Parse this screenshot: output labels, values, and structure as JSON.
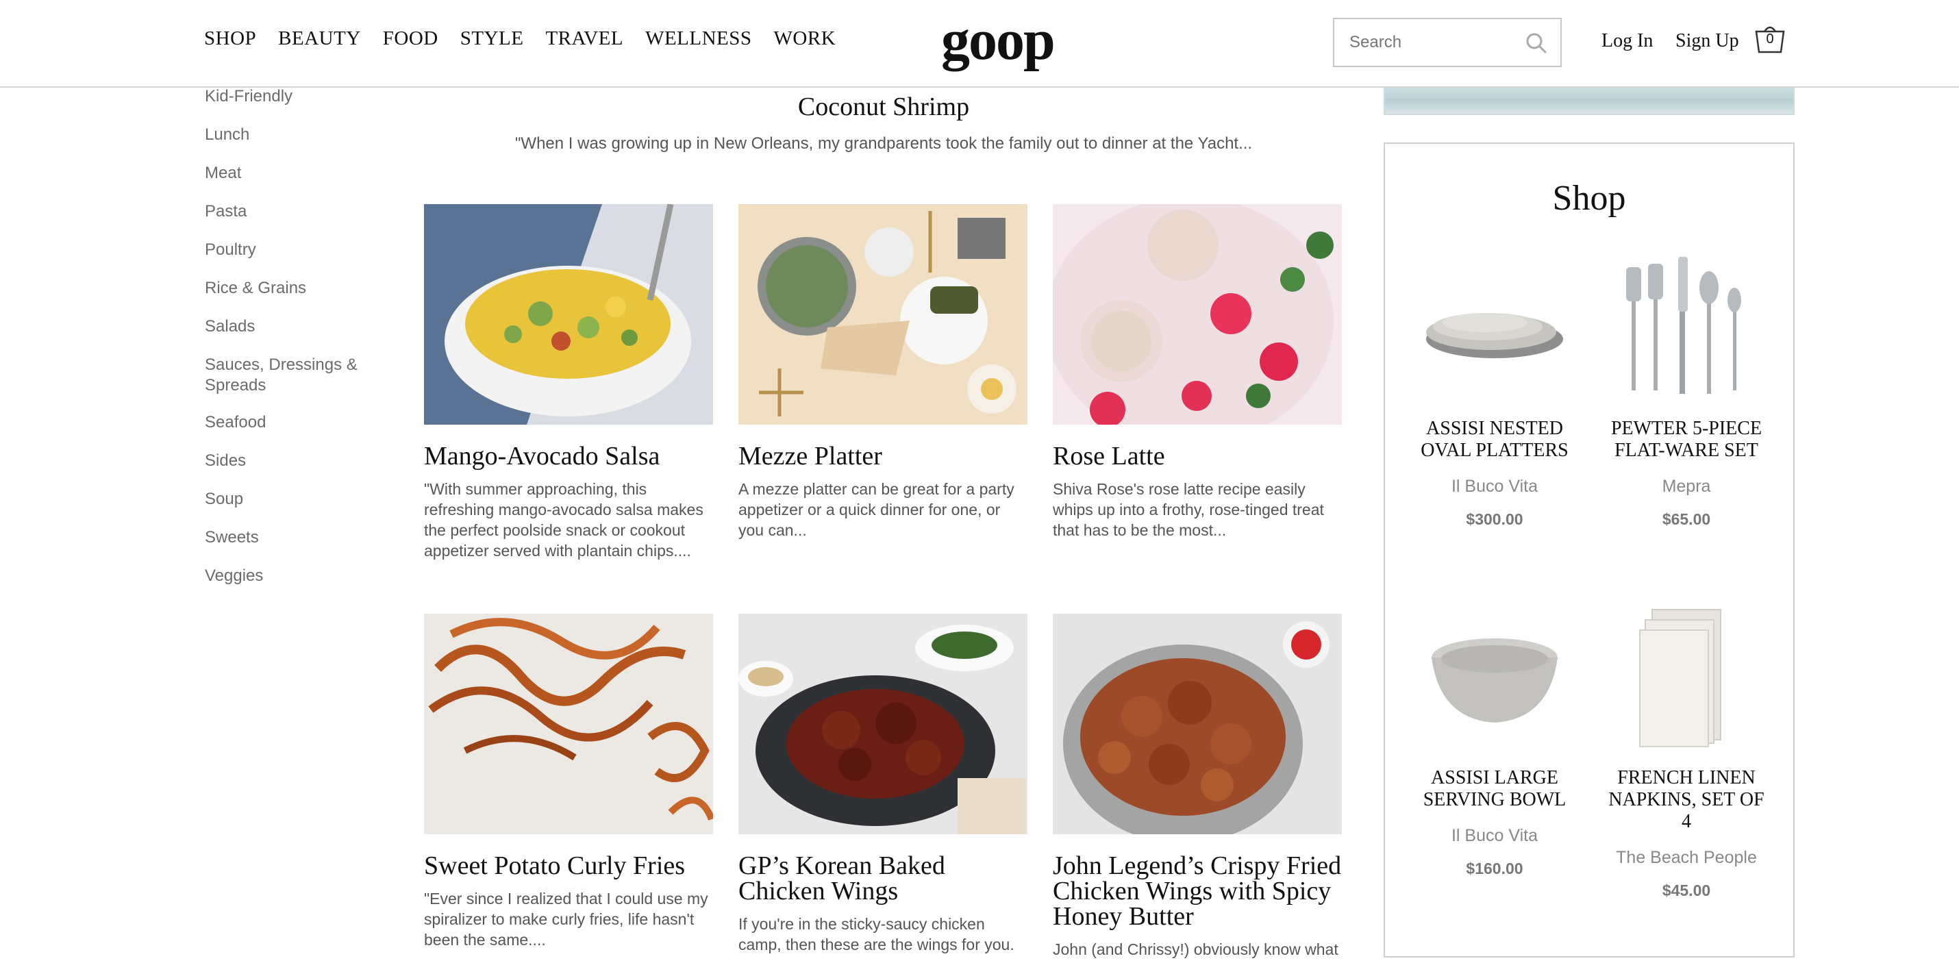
{
  "header": {
    "nav": [
      "SHOP",
      "BEAUTY",
      "FOOD",
      "STYLE",
      "TRAVEL",
      "WELLNESS",
      "WORK"
    ],
    "logo": "goop",
    "search_placeholder": "Search",
    "login": "Log In",
    "signup": "Sign Up",
    "cart_count": "0"
  },
  "sidebar": {
    "items": [
      "Kid-Friendly",
      "Lunch",
      "Meat",
      "Pasta",
      "Poultry",
      "Rice & Grains",
      "Salads",
      "Sauces, Dressings & Spreads",
      "Seafood",
      "Sides",
      "Soup",
      "Sweets",
      "Veggies"
    ]
  },
  "feature": {
    "title": "Coconut Shrimp",
    "desc": "\"When I was growing up in New Orleans, my grandparents took the family out to dinner at the Yacht..."
  },
  "recipes": [
    {
      "title": "Mango-Avocado Salsa",
      "desc": "\"With summer approaching, this refreshing mango-avocado salsa makes the perfect poolside snack or cookout appetizer served with plantain chips...."
    },
    {
      "title": "Mezze Platter",
      "desc": "A mezze platter can be great for a party appetizer or a quick dinner for one, or you can..."
    },
    {
      "title": "Rose Latte",
      "desc": "Shiva Rose's rose latte recipe easily whips up into a frothy, rose-tinged treat that has to be the most..."
    },
    {
      "title": "Sweet Potato Curly Fries",
      "desc": "\"Ever since I realized that I could use my spiralizer to make curly fries, life hasn't been the same...."
    },
    {
      "title": "GP’s Korean Baked Chicken Wings",
      "desc": "If you're in the sticky-saucy chicken camp, then these are the wings for you."
    },
    {
      "title": "John Legend’s Crispy Fried Chicken Wings with Spicy Honey Butter",
      "desc": "John (and Chrissy!) obviously know what"
    }
  ],
  "shop": {
    "title": "Shop",
    "products": [
      {
        "name": "ASSISI NESTED OVAL PLATTERS",
        "brand": "Il Buco Vita",
        "price": "$300.00"
      },
      {
        "name": "PEWTER 5-PIECE FLAT-WARE SET",
        "brand": "Mepra",
        "price": "$65.00"
      },
      {
        "name": "ASSISI LARGE SERVING BOWL",
        "brand": "Il Buco Vita",
        "price": "$160.00"
      },
      {
        "name": "FRENCH LINEN NAPKINS, SET OF 4",
        "brand": "The Beach People",
        "price": "$45.00"
      }
    ]
  }
}
